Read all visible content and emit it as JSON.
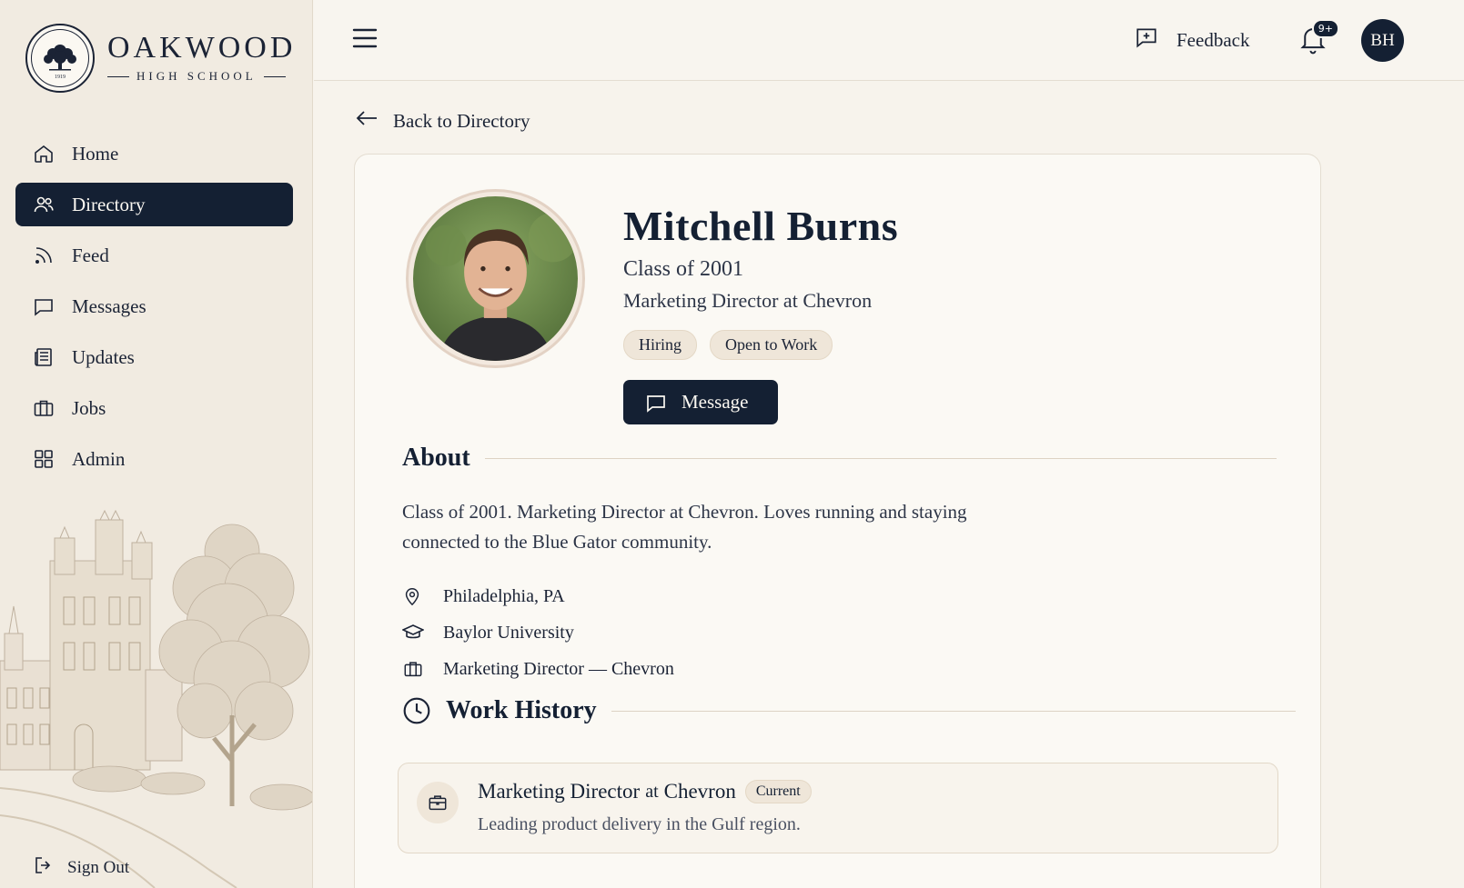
{
  "brand": {
    "name": "OAKWOOD",
    "subtitle": "HIGH SCHOOL",
    "seal_year": "1919"
  },
  "sidebar": {
    "items": [
      {
        "label": "Home",
        "icon": "home-icon",
        "active": false
      },
      {
        "label": "Directory",
        "icon": "users-icon",
        "active": true
      },
      {
        "label": "Feed",
        "icon": "rss-icon",
        "active": false
      },
      {
        "label": "Messages",
        "icon": "chat-icon",
        "active": false
      },
      {
        "label": "Updates",
        "icon": "newspaper-icon",
        "active": false
      },
      {
        "label": "Jobs",
        "icon": "briefcase-icon",
        "active": false
      },
      {
        "label": "Admin",
        "icon": "grid-icon",
        "active": false
      }
    ],
    "signout_label": "Sign Out"
  },
  "topbar": {
    "feedback_label": "Feedback",
    "notification_count": "9+",
    "user_initials": "BH"
  },
  "back_label": "Back to Directory",
  "profile": {
    "name": "Mitchell Burns",
    "class_of": "Class of 2001",
    "role": "Marketing Director at Chevron",
    "tags": [
      "Hiring",
      "Open to Work"
    ],
    "message_label": "Message"
  },
  "about": {
    "heading": "About",
    "text_line1": "Class of 2001. Marketing Director at Chevron. Loves running and staying",
    "text_line2": "connected to the Blue Gator community.",
    "facts": [
      {
        "icon": "map-pin-icon",
        "text": "Philadelphia, PA"
      },
      {
        "icon": "graduation-cap-icon",
        "text": "Baylor University"
      },
      {
        "icon": "briefcase-icon",
        "text": "Marketing Director — Chevron"
      }
    ]
  },
  "work_history": {
    "heading": "Work History",
    "jobs": [
      {
        "title": "Marketing Director",
        "at": "at",
        "company": "Chevron",
        "badge": "Current",
        "description": "Leading product delivery in the Gulf region."
      }
    ]
  },
  "colors": {
    "navy": "#142033",
    "cream": "#f7f3ec",
    "tag": "#efe6d9"
  }
}
